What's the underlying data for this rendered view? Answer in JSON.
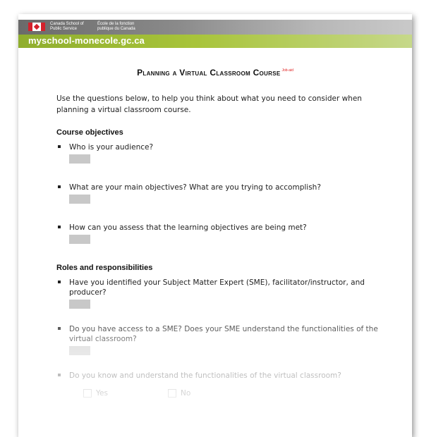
{
  "banner": {
    "agency_en": "Canada School of Public Service",
    "agency_fr": "École de la fonction publique du Canada",
    "site_url": "myschool-monecole.gc.ca"
  },
  "document": {
    "title": "Planning a Virtual Classroom Course",
    "title_tag": "Job-aid",
    "intro": "Use the questions below, to help you think about what you need to consider when planning a virtual classroom course."
  },
  "sections": [
    {
      "heading": "Course objectives",
      "questions": [
        "Who is your audience?",
        "What are your main objectives? What are you trying to accomplish?",
        "How can you assess that the learning objectives are being met?"
      ]
    },
    {
      "heading": "Roles and responsibilities",
      "questions": [
        "Have you identified your Subject Matter Expert (SME), facilitator/instructor,  and producer?",
        "Do you have access to a SME? Does your SME understand the functionalities of the virtual classroom?",
        "Do you know and understand the functionalities of the virtual classroom?"
      ]
    }
  ],
  "checkbox_options": [
    "Yes",
    "No"
  ],
  "colors": {
    "banner_gray": "#8a8a8a",
    "banner_green": "#a8c43a",
    "flag_red": "#d3212c",
    "title_tag_red": "#e02020",
    "answer_box": "#c8c8c8"
  }
}
